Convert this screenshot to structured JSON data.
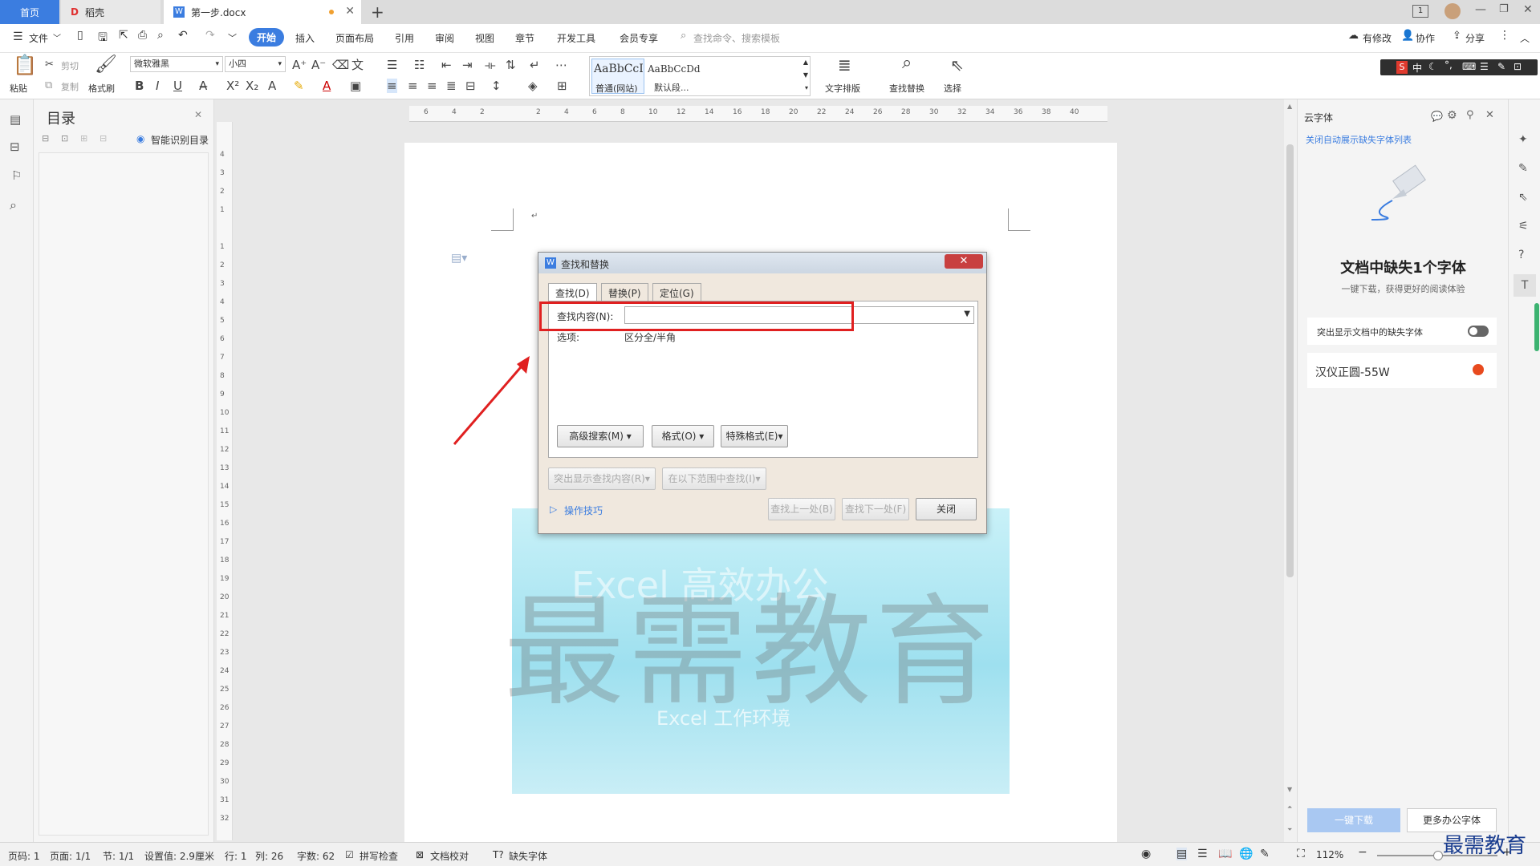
{
  "tabs": {
    "home": "首页",
    "daoke": "稻壳",
    "doc": "第一步.docx",
    "new": "+"
  },
  "menu": {
    "file": "文件",
    "items": [
      "开始",
      "插入",
      "页面布局",
      "引用",
      "审阅",
      "视图",
      "章节",
      "开发工具",
      "会员专享"
    ],
    "search": "查找命令、搜索模板",
    "modified": "有修改",
    "collab": "协作",
    "share": "分享"
  },
  "toolbar": {
    "paste": "粘贴",
    "cut": "剪切",
    "copy": "复制",
    "format_painter": "格式刷",
    "font": "微软雅黑",
    "size": "小四",
    "style1_preview": "AaBbCcI",
    "style1_name": "普通(网站)",
    "style2_preview": "AaBbCcDd",
    "style2_name": "默认段...",
    "text_layout": "文字排版",
    "find_replace": "查找替换",
    "select": "选择",
    "ime": "中"
  },
  "nav": {
    "title": "目录",
    "smart": "智能识别目录"
  },
  "ruler": {
    "h": [
      "6",
      "4",
      "2",
      "",
      "2",
      "4",
      "6",
      "8",
      "10",
      "12",
      "14",
      "16",
      "18",
      "20",
      "22",
      "24",
      "26",
      "28",
      "30",
      "32",
      "34",
      "36",
      "38",
      "40"
    ],
    "v": [
      "4",
      "3",
      "2",
      "1",
      "",
      "1",
      "2",
      "3",
      "4",
      "5",
      "6",
      "7",
      "8",
      "9",
      "10",
      "11",
      "12",
      "13",
      "14",
      "15",
      "16",
      "17",
      "18",
      "19",
      "20",
      "21",
      "22",
      "23",
      "24",
      "25",
      "26",
      "27",
      "28",
      "29",
      "30",
      "31",
      "32"
    ]
  },
  "watermark": {
    "top": "Excel 高效办公",
    "big": "最需教育",
    "bottom": "Excel 工作环境"
  },
  "dialog": {
    "title": "查找和替换",
    "tabs": [
      "查找(D)",
      "替换(P)",
      "定位(G)"
    ],
    "find_label": "查找内容(N):",
    "find_value": "",
    "options_label": "选项:",
    "options_value": "区分全/半角",
    "advanced": "高级搜索(M)",
    "format": "格式(O)",
    "special": "特殊格式(E)",
    "highlight": "突出显示查找内容(R)",
    "in_range": "在以下范围中查找(I)",
    "tips": "操作技巧",
    "prev": "查找上一处(B)",
    "next": "查找下一处(F)",
    "close": "关闭"
  },
  "right_panel": {
    "header": "云字体",
    "close_link": "关闭自动展示缺失字体列表",
    "heading": "文档中缺失1个字体",
    "sub": "一键下载，获得更好的阅读体验",
    "toggle_label": "突出显示文档中的缺失字体",
    "font_name": "汉仪正圆-55W",
    "download": "一键下载",
    "more": "更多办公字体"
  },
  "status": {
    "page": "页码: 1",
    "pages": "页面: 1/1",
    "section": "节: 1/1",
    "setting": "设置值: 2.9厘米",
    "row": "行: 1",
    "col": "列: 26",
    "words": "字数: 62",
    "spell": "拼写检查",
    "proof": "文档校对",
    "missing_font": "缺失字体",
    "zoom": "112%"
  },
  "logo_text": "最需教育"
}
